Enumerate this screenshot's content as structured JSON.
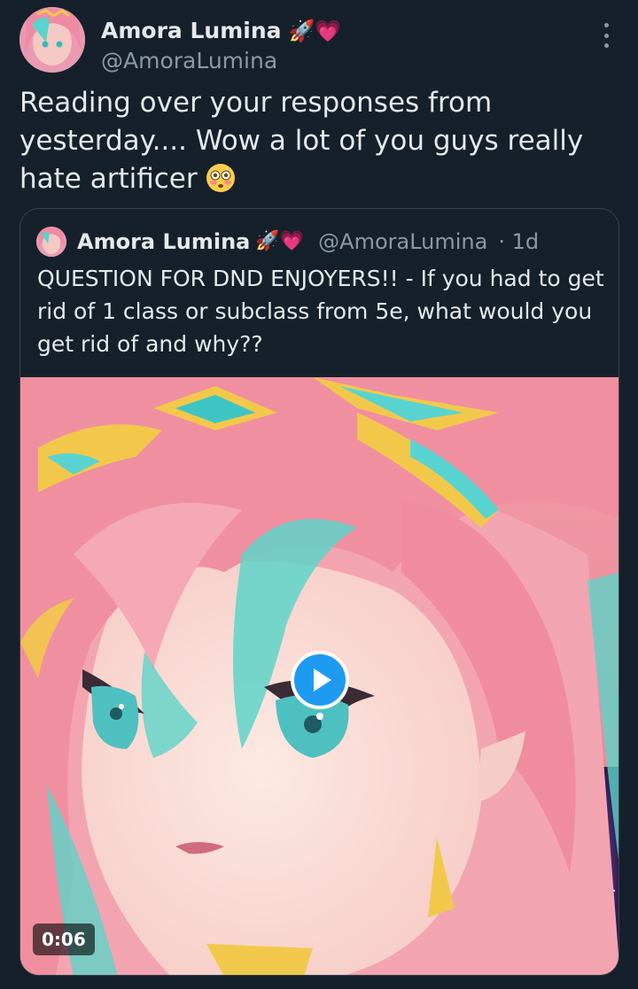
{
  "tweet": {
    "author": {
      "display_name": "Amora Lumina",
      "emojis": "🚀💗",
      "handle": "@AmoraLumina"
    },
    "text": "Reading over your responses from yesterday.... Wow a lot of you guys really hate artificer",
    "text_emoji": "flushed-face-emoji",
    "more_icon": "more-vertical-icon"
  },
  "quoted_tweet": {
    "author": {
      "display_name": "Amora Lumina",
      "emojis": "🚀💗",
      "handle": "@AmoraLumina"
    },
    "time": "· 1d",
    "text": "QUESTION FOR DND ENJOYERS!! - If you had to get rid of 1 class or subclass from 5e, what would you get rid of and why??",
    "video": {
      "duration": "0:06",
      "play_icon": "play-icon"
    }
  },
  "colors": {
    "background": "#15202b",
    "text": "#e7e9ea",
    "secondary_text": "#8b98a5",
    "border": "#38444d",
    "accent": "#1d9bf0"
  }
}
